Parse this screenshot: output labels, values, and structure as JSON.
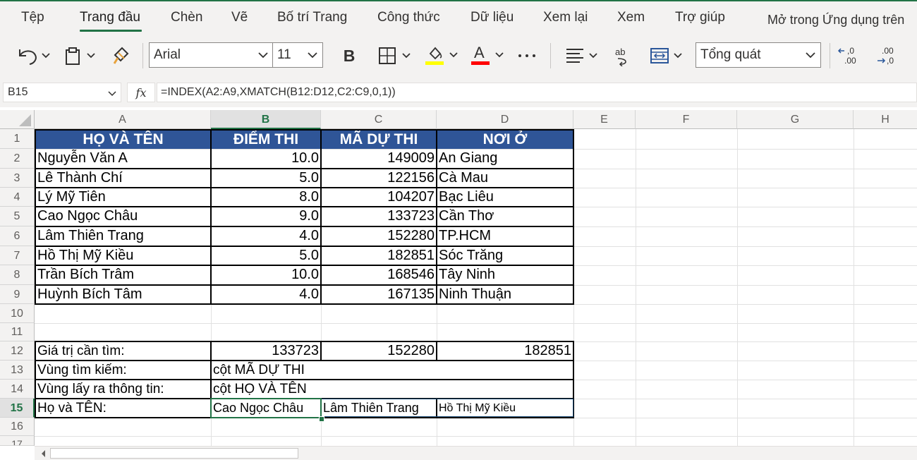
{
  "menu": {
    "tabs": [
      "Tệp",
      "Trang đầu",
      "Chèn",
      "Vẽ",
      "Bố trí Trang",
      "Công thức",
      "Dữ liệu",
      "Xem lại",
      "Xem",
      "Trợ giúp"
    ],
    "open_in_app": "Mở trong Ứng dụng trên"
  },
  "ribbon": {
    "font_name": "Arial",
    "font_size": "11",
    "bold_label": "B",
    "font_color_label": "A",
    "number_format": "Tổng quát",
    "highlight_color": "#ffff00",
    "font_color": "#ff0000"
  },
  "formula_bar": {
    "name_box": "B15",
    "fx_label": "fx",
    "formula": "=INDEX(A2:A9,XMATCH(B12:D12,C2:C9,0,1))"
  },
  "columns": [
    "A",
    "B",
    "C",
    "D",
    "E",
    "F",
    "G",
    "H"
  ],
  "rows": [
    "1",
    "2",
    "3",
    "4",
    "5",
    "6",
    "7",
    "8",
    "9",
    "10",
    "11",
    "12",
    "13",
    "14",
    "15",
    "16",
    "17"
  ],
  "table": {
    "headers": [
      "HỌ VÀ TÊN",
      "ĐIỂM THI",
      "MÃ DỰ THI",
      "NƠI Ở"
    ],
    "header_fill": "#2f5597",
    "rows": [
      [
        "Nguyễn Văn A",
        "10.0",
        "149009",
        "An Giang"
      ],
      [
        "Lê Thành Chí",
        "5.0",
        "122156",
        "Cà Mau"
      ],
      [
        "Lý Mỹ Tiên",
        "8.0",
        "104207",
        "Bạc Liêu"
      ],
      [
        "Cao Ngọc Châu",
        "9.0",
        "133723",
        "Cần Thơ"
      ],
      [
        "Lâm Thiên Trang",
        "4.0",
        "152280",
        "TP.HCM"
      ],
      [
        "Hồ Thị Mỹ Kiều",
        "5.0",
        "182851",
        "Sóc Trăng"
      ],
      [
        "Trần Bích Trâm",
        "10.0",
        "168546",
        "Tây Ninh"
      ],
      [
        "Huỳnh Bích Tâm",
        "4.0",
        "167135",
        "Ninh Thuận"
      ]
    ]
  },
  "lookup": {
    "r12_label": "Giá trị cần tìm:",
    "r12_values": [
      "133723",
      "152280",
      "182851"
    ],
    "r13_label": "Vùng tìm kiếm:",
    "r13_value": "cột MÃ DỰ THI",
    "r14_label": "Vùng lấy ra thông tin:",
    "r14_value": "cột HỌ VÀ TÊN",
    "r15_label": "Họ và TÊN:",
    "r15_values": [
      "Cao Ngọc Châu",
      "Lâm Thiên Trang",
      "Hồ Thị Mỹ Kiều"
    ]
  },
  "selected_cell": "B15",
  "accent_color": "#217346"
}
